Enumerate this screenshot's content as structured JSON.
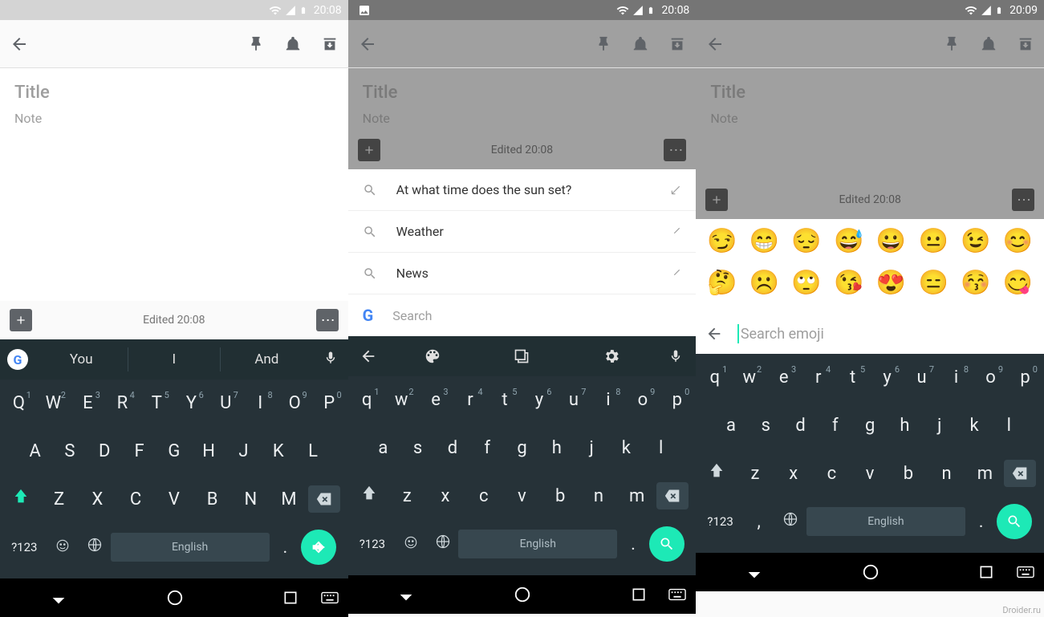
{
  "status": {
    "time_a": "20:08",
    "time_b": "20:08",
    "time_c": "20:09"
  },
  "toolbar": {},
  "note": {
    "title_placeholder": "Title",
    "body_placeholder": "Note",
    "edited": "Edited 20:08"
  },
  "suggestions": {
    "a": "You",
    "b": "I",
    "c": "And"
  },
  "search": {
    "row1": "At what time does the sun set?",
    "row2": "Weather",
    "row3": "News",
    "placeholder": "Search"
  },
  "emoji": {
    "row1": [
      "😏",
      "😁",
      "😔",
      "😅",
      "😀",
      "😐",
      "😉",
      "😊"
    ],
    "row2": [
      "🤔",
      "☹️",
      "🙄",
      "😘",
      "😍",
      "😑",
      "😚",
      "😋"
    ],
    "search_placeholder": "Search emoji"
  },
  "keyboard": {
    "row1_upper": [
      "Q",
      "W",
      "E",
      "R",
      "T",
      "Y",
      "U",
      "I",
      "O",
      "P"
    ],
    "row1_lower": [
      "q",
      "w",
      "e",
      "r",
      "t",
      "y",
      "u",
      "i",
      "o",
      "p"
    ],
    "nums": [
      "1",
      "2",
      "3",
      "4",
      "5",
      "6",
      "7",
      "8",
      "9",
      "0"
    ],
    "row2_upper": [
      "A",
      "S",
      "D",
      "F",
      "G",
      "H",
      "J",
      "K",
      "L"
    ],
    "row2_lower": [
      "a",
      "s",
      "d",
      "f",
      "g",
      "h",
      "j",
      "k",
      "l"
    ],
    "row3_upper": [
      "Z",
      "X",
      "C",
      "V",
      "B",
      "N",
      "M"
    ],
    "row3_lower": [
      "z",
      "x",
      "c",
      "v",
      "b",
      "n",
      "m"
    ],
    "sym": "?123",
    "space": "English",
    "comma": ",",
    "period": "."
  },
  "watermark": "Droider.ru"
}
